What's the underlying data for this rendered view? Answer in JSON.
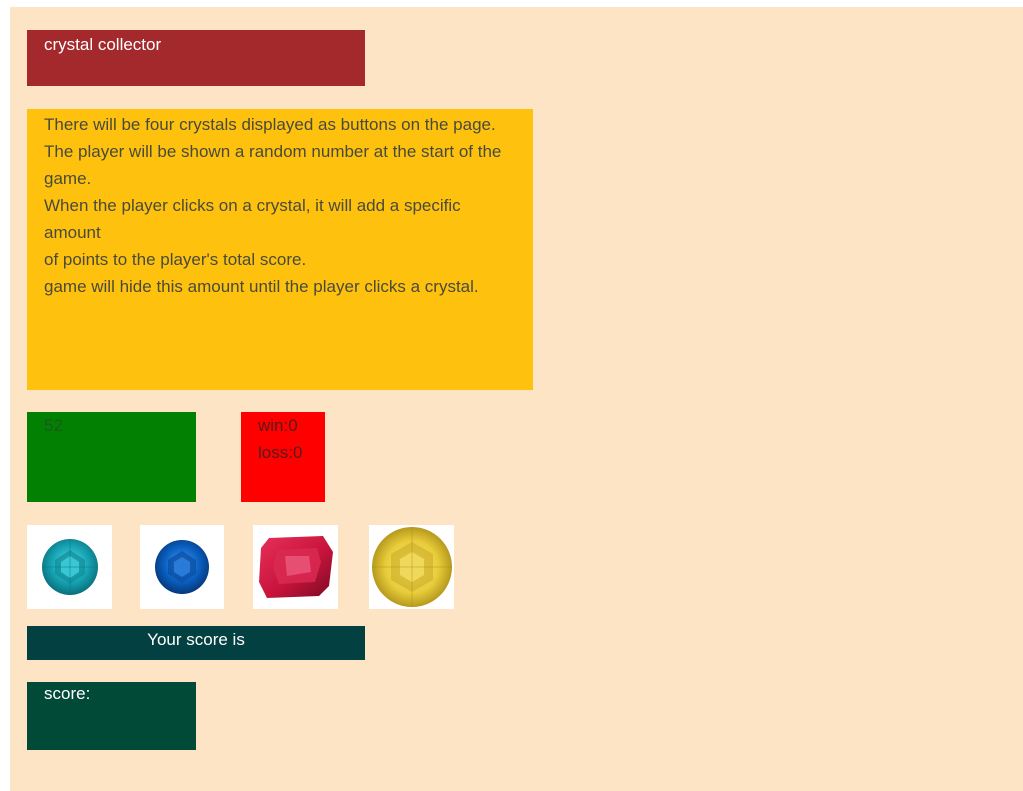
{
  "title": "crystal collector",
  "instructions": [
    "There will be four crystals displayed as buttons on the page.",
    "The player will be shown a random number at the start of the game.",
    "When the player clicks on a crystal, it will add a specific amount",
    "of points to the player's total score.",
    "game will hide this amount until the player clicks a crystal."
  ],
  "target_number": "52",
  "record": {
    "win": "win:0",
    "loss": "loss:0"
  },
  "crystals": [
    {
      "icon": "teal-crystal-icon",
      "color": "#1aa6b3"
    },
    {
      "icon": "blue-crystal-icon",
      "color": "#0a5fc0"
    },
    {
      "icon": "red-crystal-icon",
      "color": "#c8143c"
    },
    {
      "icon": "yellow-crystal-icon",
      "color": "#e8cc3a"
    }
  ],
  "score_label": "Your score is",
  "score": "score:"
}
